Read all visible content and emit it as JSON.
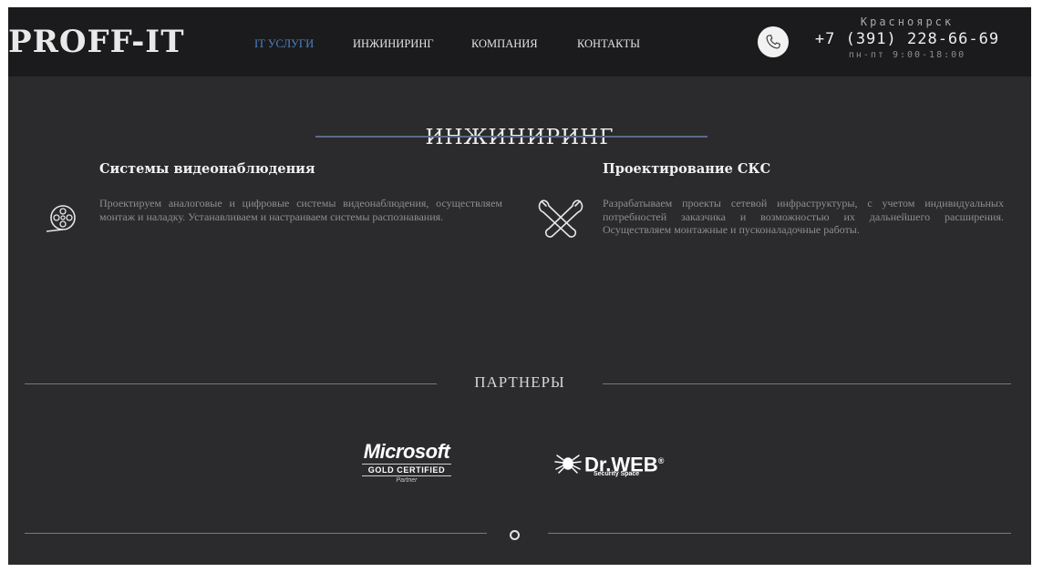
{
  "header": {
    "logo": "PROFF-IT",
    "nav": [
      {
        "label": "IT УСЛУГИ",
        "active": true
      },
      {
        "label": "ИНЖИНИРИНГ",
        "active": false
      },
      {
        "label": "КОМПАНИЯ",
        "active": false
      },
      {
        "label": "КОНТАКТЫ",
        "active": false
      }
    ],
    "contact": {
      "city": "Красноярск",
      "phone": "+7 (391) 228-66-69",
      "hours": "пн-пт 9:00-18:00",
      "icon": "phone-icon"
    }
  },
  "section": {
    "title": "ИНЖИНИРИНГ",
    "services": [
      {
        "title": "Системы видеонаблюдения",
        "text": "Проектируем аналоговые и цифровые системы видеонаблюдения, осуществляем монтаж и наладку. Устанавливаем и настраиваем системы распознавания.",
        "icon": "film-reel-icon"
      },
      {
        "title": "Проектирование СКС",
        "text": "Разрабатываем проекты сетевой инфраструктуры, с учетом индивидуальных потребностей заказчика и возможностью их дальнейшего расширения. Осуществляем монтажные и пусконаладочные работы.",
        "icon": "wrench-tools-icon"
      }
    ]
  },
  "partners": {
    "title": "ПАРТНЕРЫ",
    "microsoft": {
      "name": "Microsoft",
      "certification": "GOLD CERTIFIED",
      "tier": "Partner"
    },
    "drweb": {
      "name": "Dr.WEB",
      "registered": "®",
      "tagline": "Security Space"
    }
  },
  "colors": {
    "page_background": "#2b2a2c",
    "header_background": "#1b1b1d",
    "nav_active": "#4d86c3",
    "title_underline": "#5b6c88",
    "body_text": "#8e8e8e"
  }
}
